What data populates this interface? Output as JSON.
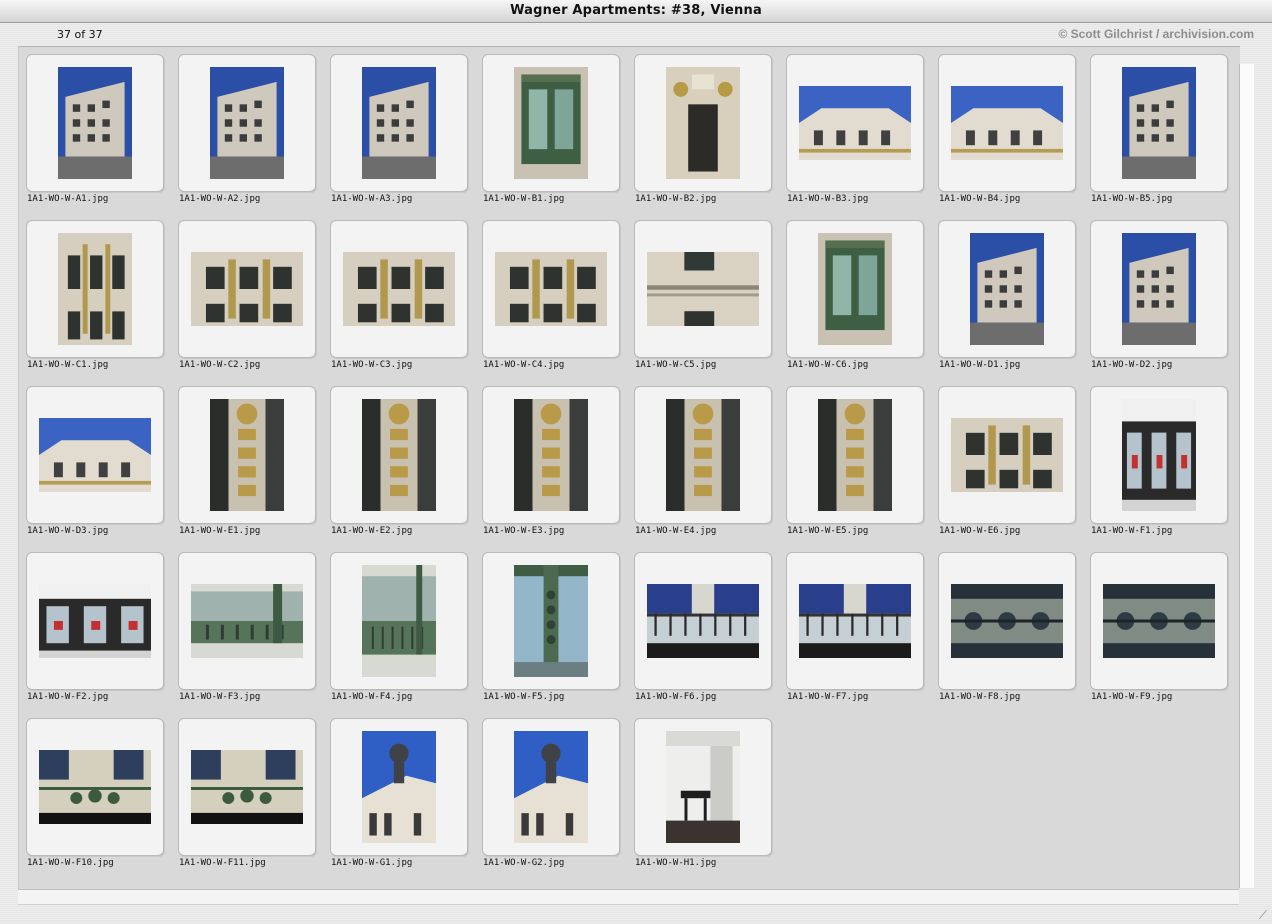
{
  "window": {
    "title": "Wagner Apartments: #38, Vienna"
  },
  "header": {
    "count_text": "37 of 37",
    "credit_text": "© Scott Gilchrist / archivision.com"
  },
  "thumbnails": [
    {
      "filename": "1A1-WO-W-A1.jpg",
      "orientation": "portrait",
      "palette": "sky-building"
    },
    {
      "filename": "1A1-WO-W-A2.jpg",
      "orientation": "portrait",
      "palette": "sky-building"
    },
    {
      "filename": "1A1-WO-W-A3.jpg",
      "orientation": "portrait",
      "palette": "sky-building"
    },
    {
      "filename": "1A1-WO-W-B1.jpg",
      "orientation": "portrait",
      "palette": "green-bay"
    },
    {
      "filename": "1A1-WO-W-B2.jpg",
      "orientation": "portrait",
      "palette": "doorway"
    },
    {
      "filename": "1A1-WO-W-B3.jpg",
      "orientation": "landscape",
      "palette": "sky-roof"
    },
    {
      "filename": "1A1-WO-W-B4.jpg",
      "orientation": "landscape",
      "palette": "sky-roof"
    },
    {
      "filename": "1A1-WO-W-B5.jpg",
      "orientation": "portrait",
      "palette": "sky-building"
    },
    {
      "filename": "1A1-WO-W-C1.jpg",
      "orientation": "portrait",
      "palette": "facade-windows"
    },
    {
      "filename": "1A1-WO-W-C2.jpg",
      "orientation": "landscape",
      "palette": "facade-windows"
    },
    {
      "filename": "1A1-WO-W-C3.jpg",
      "orientation": "landscape",
      "palette": "facade-windows"
    },
    {
      "filename": "1A1-WO-W-C4.jpg",
      "orientation": "landscape",
      "palette": "facade-windows"
    },
    {
      "filename": "1A1-WO-W-C5.jpg",
      "orientation": "landscape",
      "palette": "plain-facade"
    },
    {
      "filename": "1A1-WO-W-C6.jpg",
      "orientation": "portrait",
      "palette": "green-bay"
    },
    {
      "filename": "1A1-WO-W-D1.jpg",
      "orientation": "portrait",
      "palette": "sky-building"
    },
    {
      "filename": "1A1-WO-W-D2.jpg",
      "orientation": "portrait",
      "palette": "sky-building"
    },
    {
      "filename": "1A1-WO-W-D3.jpg",
      "orientation": "landscape",
      "palette": "sky-roof"
    },
    {
      "filename": "1A1-WO-W-E1.jpg",
      "orientation": "portrait",
      "palette": "gold-ornament"
    },
    {
      "filename": "1A1-WO-W-E2.jpg",
      "orientation": "portrait",
      "palette": "gold-ornament"
    },
    {
      "filename": "1A1-WO-W-E3.jpg",
      "orientation": "portrait",
      "palette": "gold-ornament"
    },
    {
      "filename": "1A1-WO-W-E4.jpg",
      "orientation": "portrait",
      "palette": "gold-ornament"
    },
    {
      "filename": "1A1-WO-W-E5.jpg",
      "orientation": "portrait",
      "palette": "gold-ornament"
    },
    {
      "filename": "1A1-WO-W-E6.jpg",
      "orientation": "landscape",
      "palette": "facade-windows"
    },
    {
      "filename": "1A1-WO-W-F1.jpg",
      "orientation": "portrait",
      "palette": "storefront"
    },
    {
      "filename": "1A1-WO-W-F2.jpg",
      "orientation": "landscape",
      "palette": "storefront"
    },
    {
      "filename": "1A1-WO-W-F3.jpg",
      "orientation": "landscape",
      "palette": "green-metal"
    },
    {
      "filename": "1A1-WO-W-F4.jpg",
      "orientation": "portrait",
      "palette": "green-metal"
    },
    {
      "filename": "1A1-WO-W-F5.jpg",
      "orientation": "portrait",
      "palette": "green-column"
    },
    {
      "filename": "1A1-WO-W-F6.jpg",
      "orientation": "landscape",
      "palette": "railing"
    },
    {
      "filename": "1A1-WO-W-F7.jpg",
      "orientation": "landscape",
      "palette": "railing"
    },
    {
      "filename": "1A1-WO-W-F8.jpg",
      "orientation": "landscape",
      "palette": "iron-ornament"
    },
    {
      "filename": "1A1-WO-W-F9.jpg",
      "orientation": "landscape",
      "palette": "iron-ornament"
    },
    {
      "filename": "1A1-WO-W-F10.jpg",
      "orientation": "landscape",
      "palette": "balcony"
    },
    {
      "filename": "1A1-WO-W-F11.jpg",
      "orientation": "landscape",
      "palette": "balcony"
    },
    {
      "filename": "1A1-WO-W-G1.jpg",
      "orientation": "portrait",
      "palette": "statue-sky"
    },
    {
      "filename": "1A1-WO-W-G2.jpg",
      "orientation": "portrait",
      "palette": "statue-sky"
    },
    {
      "filename": "1A1-WO-W-H1.jpg",
      "orientation": "portrait",
      "palette": "interior"
    }
  ]
}
